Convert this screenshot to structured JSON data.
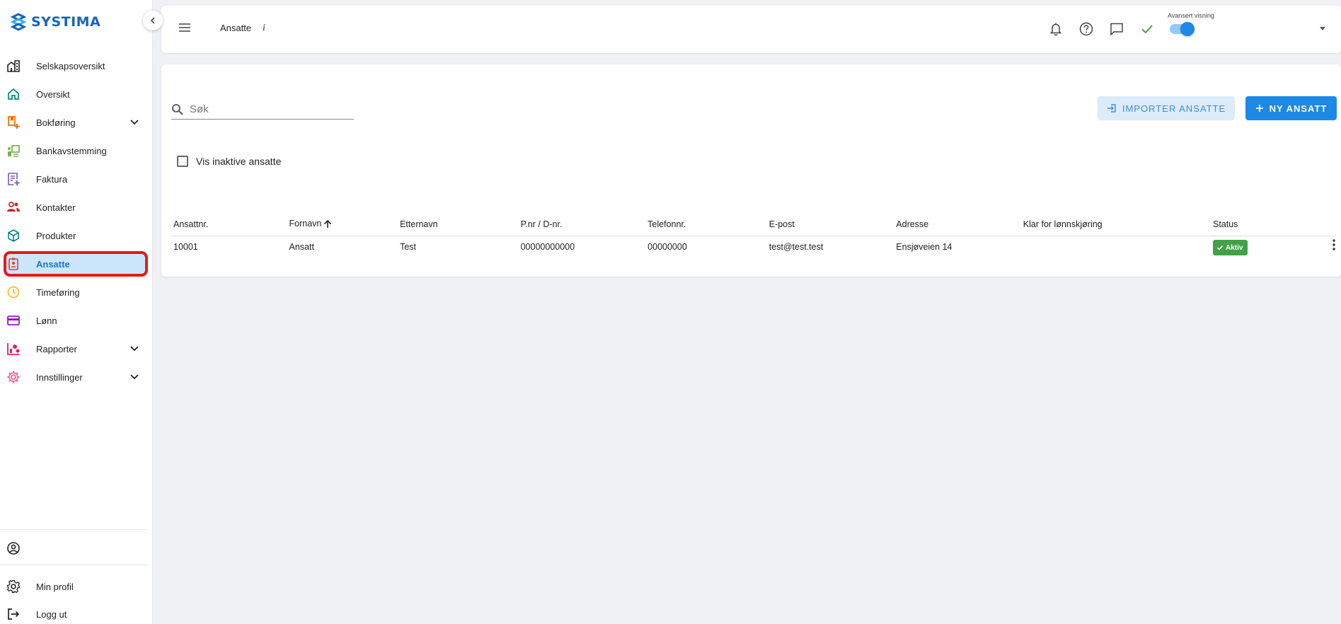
{
  "app": {
    "brand": "SYSTIMA",
    "brand_color": "#1565c0",
    "accent": "#1e88e5"
  },
  "sidebar": {
    "items": [
      {
        "label": "Selskapsoversikt",
        "icon": "buildings-icon",
        "color": "#222222"
      },
      {
        "label": "Oversikt",
        "icon": "home-icon",
        "color": "#00897b"
      },
      {
        "label": "Bokføring",
        "icon": "bookkeeping-icon",
        "color": "#ef6c00",
        "expandable": true
      },
      {
        "label": "Bankavstemming",
        "icon": "bank-reconciliation-icon",
        "color": "#7cb342"
      },
      {
        "label": "Faktura",
        "icon": "invoice-icon",
        "color": "#7e57c2"
      },
      {
        "label": "Kontakter",
        "icon": "contacts-icon",
        "color": "#c62828"
      },
      {
        "label": "Produkter",
        "icon": "cube-icon",
        "color": "#00897b"
      },
      {
        "label": "Ansatte",
        "icon": "employee-badge-icon",
        "color": "#e53935",
        "active": true
      },
      {
        "label": "Timeføring",
        "icon": "clock-icon",
        "color": "#fbc02d"
      },
      {
        "label": "Lønn",
        "icon": "card-icon",
        "color": "#8e24aa"
      },
      {
        "label": "Rapporter",
        "icon": "reports-icon",
        "color": "#e91e63",
        "expandable": true
      },
      {
        "label": "Innstillinger",
        "icon": "gear-icon",
        "color": "#f06292",
        "expandable": true
      }
    ],
    "bottom": {
      "profile_label": "Min profil",
      "logout_label": "Logg ut"
    }
  },
  "topbar": {
    "title": "Ansatte",
    "info": "i",
    "advanced_view_label": "Avansert visning",
    "advanced_view_on": true
  },
  "toolbar": {
    "search_placeholder": "Søk",
    "import_label": "IMPORTER ANSATTE",
    "new_label": "NY ANSATT",
    "show_inactive_label": "Vis inaktive ansatte",
    "show_inactive_checked": false
  },
  "table": {
    "columns": [
      "Ansattnr.",
      "Fornavn",
      "Etternavn",
      "P.nr / D-nr.",
      "Telefonnr.",
      "E-post",
      "Adresse",
      "Klar for lønnskjøring",
      "Status"
    ],
    "sorted_column": "Fornavn",
    "sort_direction": "ascending",
    "rows": [
      {
        "ansattnr": "10001",
        "fornavn": "Ansatt",
        "etternavn": "Test",
        "pnr": "00000000000",
        "telefon": "00000000",
        "epost": "test@test.test",
        "adresse": "Ensjøveien 14",
        "klar": "",
        "status": "Aktiv",
        "status_color": "#43a047"
      }
    ]
  }
}
